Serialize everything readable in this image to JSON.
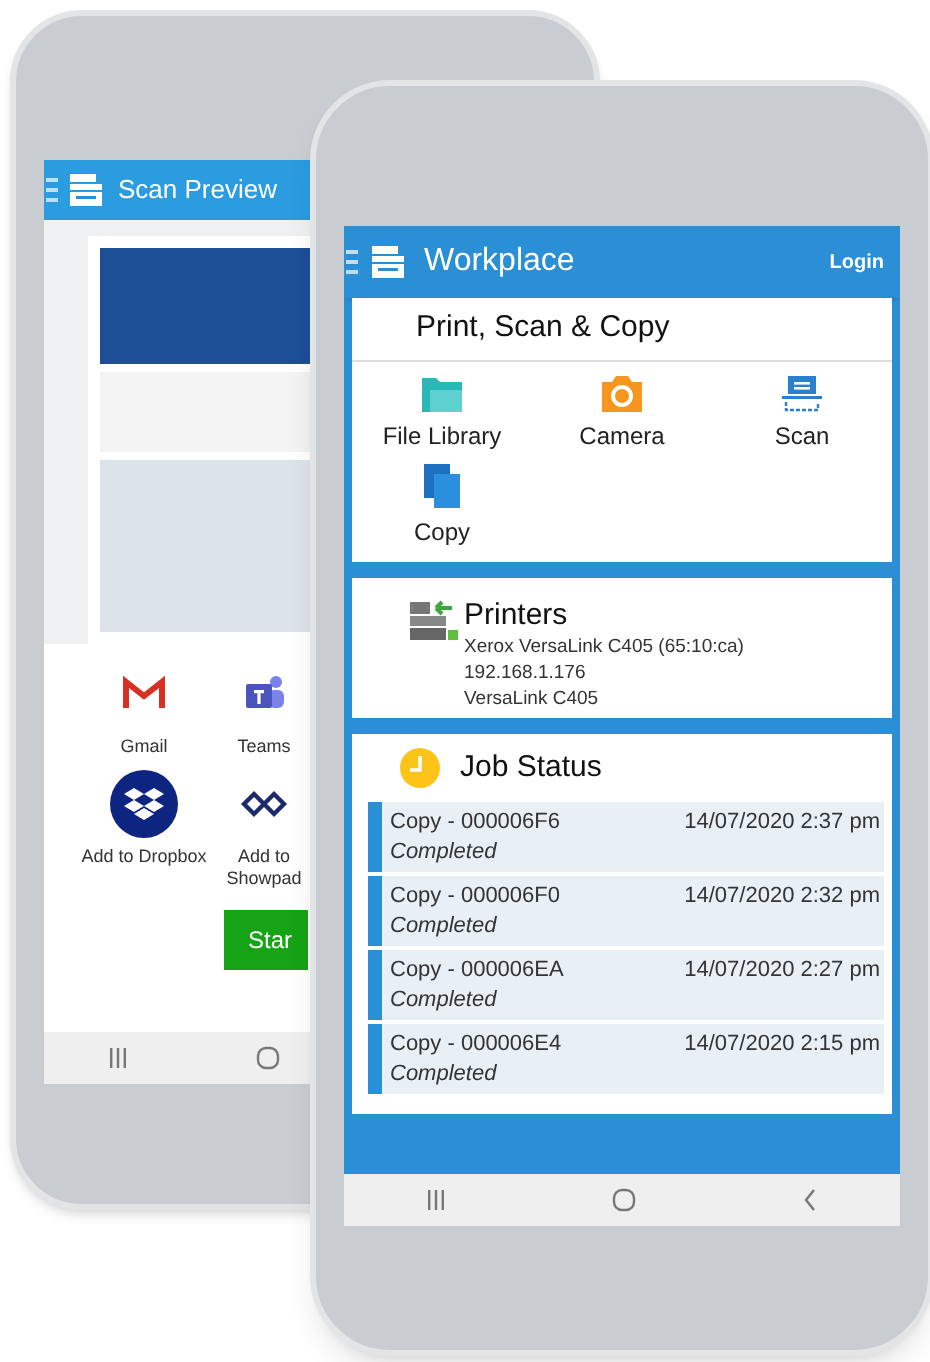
{
  "back_phone": {
    "header": {
      "title": "Scan Preview"
    },
    "share_targets": [
      {
        "label": "Gmail",
        "kind": "gmail"
      },
      {
        "label": "Teams",
        "kind": "teams"
      },
      {
        "label": "Add to Dropbox",
        "kind": "dropbox"
      },
      {
        "label": "Add to Showpad",
        "kind": "showpad"
      }
    ],
    "start_button": "Star"
  },
  "front_phone": {
    "header": {
      "title": "Workplace",
      "login": "Login"
    },
    "actions_card": {
      "title": "Print, Scan & Copy",
      "actions": [
        {
          "label": "File Library",
          "kind": "folder"
        },
        {
          "label": "Camera",
          "kind": "camera"
        },
        {
          "label": "Scan",
          "kind": "scan"
        },
        {
          "label": "Copy",
          "kind": "copy"
        }
      ]
    },
    "printers_card": {
      "title": "Printers",
      "lines": [
        "Xerox VersaLink C405 (65:10:ca)",
        "192.168.1.176",
        "VersaLink C405"
      ]
    },
    "job_status": {
      "title": "Job Status",
      "jobs": [
        {
          "name": "Copy - 000006F6",
          "status": "Completed",
          "time": "14/07/2020 2:37 pm"
        },
        {
          "name": "Copy - 000006F0",
          "status": "Completed",
          "time": "14/07/2020 2:32 pm"
        },
        {
          "name": "Copy - 000006EA",
          "status": "Completed",
          "time": "14/07/2020 2:27 pm"
        },
        {
          "name": "Copy - 000006E4",
          "status": "Completed",
          "time": "14/07/2020 2:15 pm"
        }
      ]
    }
  }
}
